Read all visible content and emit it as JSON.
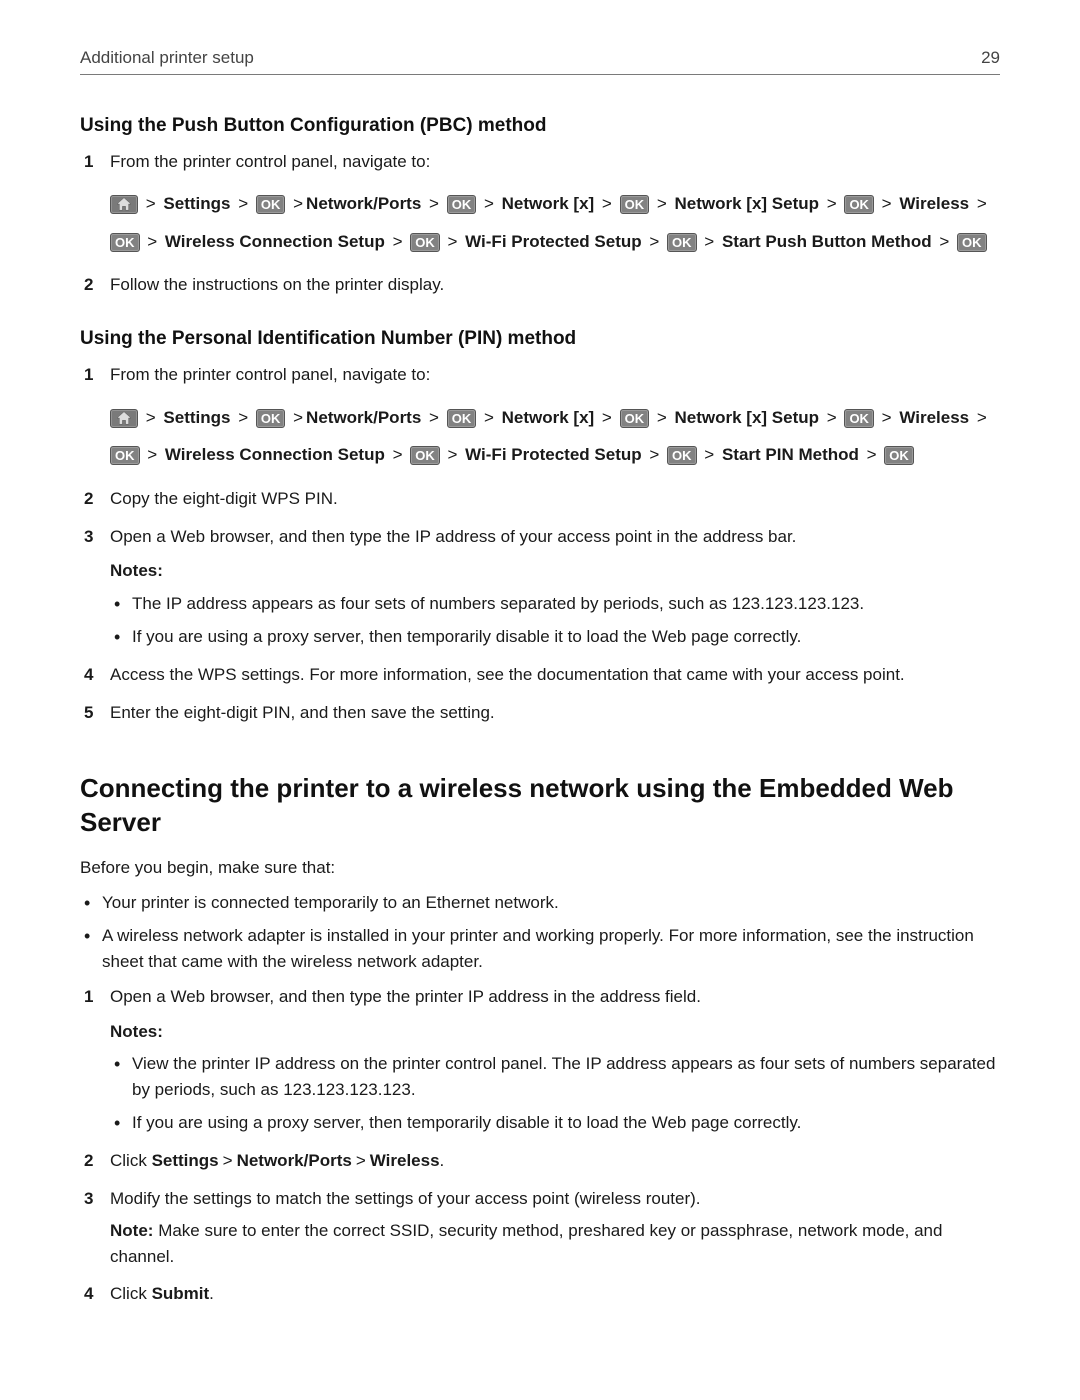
{
  "header": {
    "title": "Additional printer setup",
    "page": "29"
  },
  "labels": {
    "ok": "OK",
    "notes": "Notes:",
    "note_inline": "Note:"
  },
  "pbc": {
    "heading": "Using the Push Button Configuration (PBC) method",
    "step1": "From the printer control panel, navigate to:",
    "nav": {
      "settings": "Settings",
      "network_ports": "Network/Ports",
      "network_x": "Network [x]",
      "network_x_setup": "Network [x] Setup",
      "wireless": "Wireless",
      "wireless_conn_setup": "Wireless Connection Setup",
      "wifi_protected_setup": "Wi-Fi Protected Setup",
      "start_push": "Start Push Button Method"
    },
    "step2": "Follow the instructions on the printer display."
  },
  "pin": {
    "heading": "Using the Personal Identification Number (PIN) method",
    "step1": "From the printer control panel, navigate to:",
    "nav": {
      "settings": "Settings",
      "network_ports": "Network/Ports",
      "network_x": "Network [x]",
      "network_x_setup": "Network [x] Setup",
      "wireless": "Wireless",
      "wireless_conn_setup": "Wireless Connection Setup",
      "wifi_protected_setup": "Wi-Fi Protected Setup",
      "start_pin": "Start PIN Method"
    },
    "step2": "Copy the eight-digit WPS PIN.",
    "step3": "Open a Web browser, and then type the IP address of your access point in the address bar.",
    "notes": [
      "The IP address appears as four sets of numbers separated by periods, such as 123.123.123.123.",
      "If you are using a proxy server, then temporarily disable it to load the Web page correctly."
    ],
    "step4": "Access the WPS settings. For more information, see the documentation that came with your access point.",
    "step5": "Enter the eight-digit PIN, and then save the setting."
  },
  "ews": {
    "heading": "Connecting the printer to a wireless network using the Embedded Web Server",
    "intro": "Before you begin, make sure that:",
    "pre": [
      "Your printer is connected temporarily to an Ethernet network.",
      "A wireless network adapter is installed in your printer and working properly. For more information, see the instruction sheet that came with the wireless network adapter."
    ],
    "step1": "Open a Web browser, and then type the printer IP address in the address field.",
    "notes": [
      "View the printer IP address on the printer control panel. The IP address appears as four sets of numbers separated by periods, such as 123.123.123.123.",
      "If you are using a proxy server, then temporarily disable it to load the Web page correctly."
    ],
    "step2_prefix": "Click ",
    "step2_parts": {
      "settings": "Settings",
      "network_ports": "Network/Ports",
      "wireless": "Wireless"
    },
    "step3": "Modify the settings to match the settings of your access point (wireless router).",
    "step3_note": "Make sure to enter the correct SSID, security method, preshared key or passphrase, network mode, and channel.",
    "step4_prefix": "Click ",
    "step4_submit": "Submit",
    "step4_suffix": "."
  }
}
